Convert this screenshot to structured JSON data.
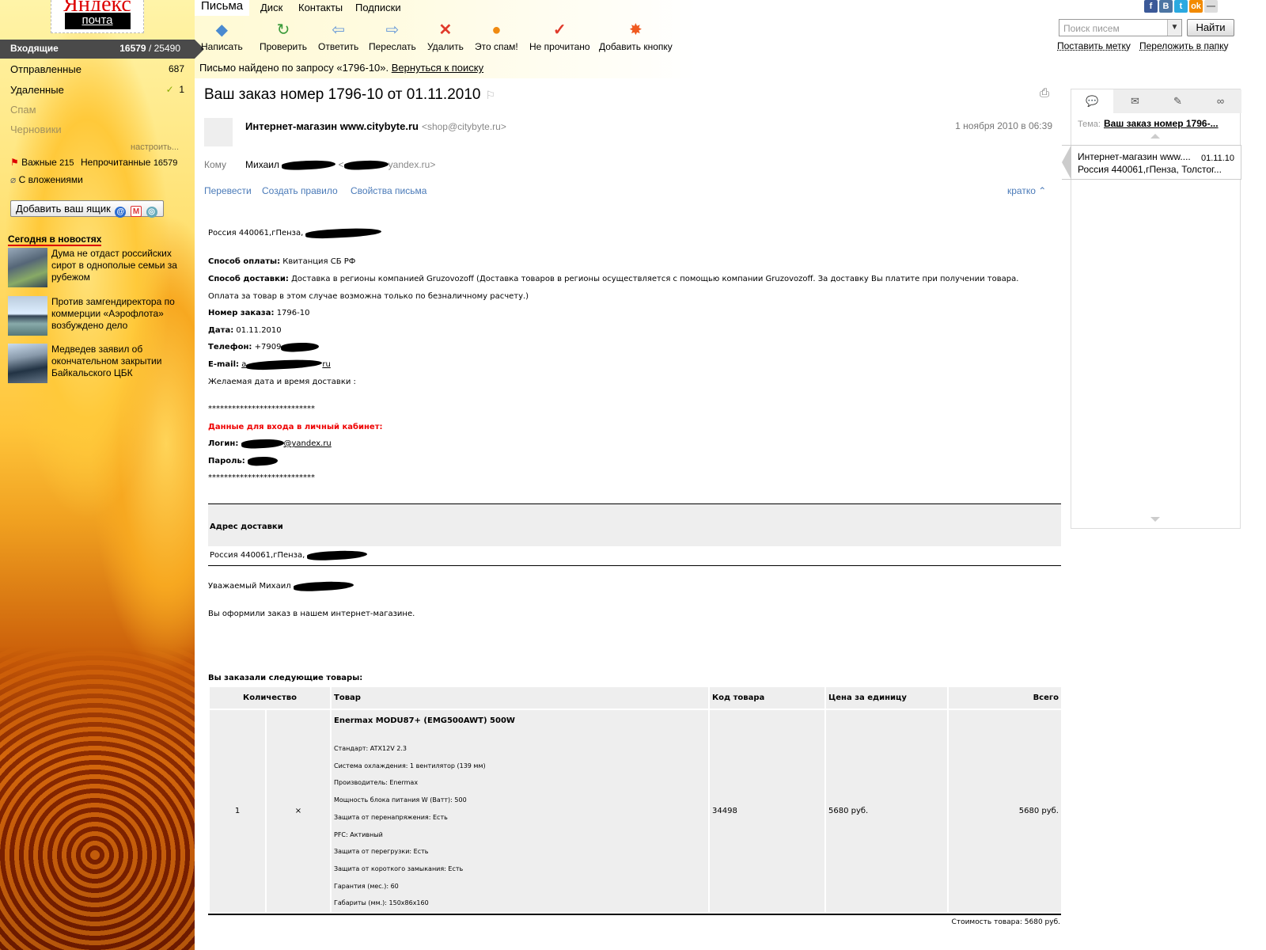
{
  "logo": {
    "brand": "Яндекс",
    "service": "почта"
  },
  "tabs": [
    {
      "label": "Письма",
      "active": true
    },
    {
      "label": "Диск"
    },
    {
      "label": "Контакты"
    },
    {
      "label": "Подписки"
    }
  ],
  "social": [
    "f",
    "B",
    "t",
    "ok",
    "—"
  ],
  "toolbar": [
    {
      "label": "Написать",
      "icon": "compose-icon"
    },
    {
      "label": "Проверить",
      "icon": "refresh-icon"
    },
    {
      "label": "Ответить",
      "icon": "reply-icon"
    },
    {
      "label": "Переслать",
      "icon": "forward-icon"
    },
    {
      "label": "Удалить",
      "icon": "delete-icon"
    },
    {
      "label": "Это спам!",
      "icon": "spam-icon"
    },
    {
      "label": "Не прочитано",
      "icon": "unread-icon"
    },
    {
      "label": "Добавить кнопку",
      "icon": "add-button-icon"
    }
  ],
  "search": {
    "placeholder": "Поиск писем",
    "button": "Найти",
    "put_label": "Поставить метку",
    "move": "Переложить в папку"
  },
  "found": {
    "text": "Письмо найдено по запросу «1796-10».",
    "back": "Вернуться к поиску"
  },
  "folders": {
    "inbox": {
      "label": "Входящие",
      "unread": "16579",
      "sep": " / ",
      "total": "25490"
    },
    "items": [
      {
        "label": "Отправленные",
        "count": "687"
      },
      {
        "label": "Удаленные",
        "count": "1"
      },
      {
        "label": "Спам",
        "count": ""
      },
      {
        "label": "Черновики",
        "count": ""
      }
    ],
    "tune": "настроить..."
  },
  "labels": {
    "important": "Важные",
    "important_count": "215",
    "unread": "Непрочитанные",
    "unread_count": "16579",
    "attach": "С вложениями"
  },
  "add_box": "Добавить ваш ящик",
  "news": {
    "title": "Сегодня в новостях",
    "items": [
      "Дума не отдаст российских сирот в однополые семьи за рубежом",
      "Против замгендиректора по коммерции «Аэрофлота» возбуждено дело",
      "Медведев заявил об окончательном закрытии Байкальского ЦБК"
    ]
  },
  "message": {
    "subject": "Ваш заказ номер 1796-10 от 01.11.2010",
    "sender_name": "Интернет-магазин www.citybyte.ru",
    "sender_addr": "<shop@citybyte.ru>",
    "date": "1 ноября 2010 в 06:39",
    "to_label": "Кому",
    "to_name": "Михаил",
    "to_addr_open": "<",
    "to_addr": "yandex.ru>",
    "actions": [
      "Перевести",
      "Создать правило",
      "Свойства письма"
    ],
    "brief": "кратко"
  },
  "body": {
    "addr1": "Россия 440061,гПенза,",
    "pay_label": "Способ оплаты:",
    "pay": "Квитанция СБ РФ",
    "ship_label": "Способ доставки:",
    "ship": "Доставка в регионы компанией Gruzovozoff (Доставка товаров в регионы осуществляется с помощью компании Gruzovozoff. За доставку Вы платите при получении товара.",
    "ship2": "Оплата за товар в этом случае возможна только по безналичному расчету.)",
    "order_label": "Номер заказа:",
    "order": "1796-10",
    "date_label": "Дата:",
    "date": "01.11.2010",
    "phone_label": "Телефон:",
    "phone": "+7909",
    "email_label": "E-mail:",
    "email_start": "a",
    "email_end": "ru",
    "wish": "Желаемая дата и время доставки :",
    "stars": "***************************",
    "cabinet": "Данные для входа в личный кабинет:",
    "login_label": "Логин:",
    "login_tail": "@yandex.ru",
    "pass_label": "Пароль:",
    "addr_head": "Адрес доставки",
    "addr2": "Россия 440061,гПенза,",
    "dear": "Уважаемый Михаил",
    "placed": "Вы оформили заказ в нашем интернет-магазине.",
    "ordered": "Вы заказали следующие товары:"
  },
  "goods": {
    "headers": [
      "Количество",
      "Товар",
      "Код товара",
      "Цена за единицу",
      "Всего"
    ],
    "qty": "1",
    "x": "×",
    "name": "Enermax MODU87+ (EMG500AWT) 500W",
    "specs": [
      "Стандарт: ATX12V 2.3",
      "Система охлаждения: 1 вентилятор (139 мм)",
      "Производитель: Enermax",
      "Мощность блока питания W (Ватт): 500",
      "Защита от перенапряжения: Есть",
      "PFC: Активный",
      "Защита от перегрузки: Есть",
      "Защита от короткого замыкания: Есть",
      "Гарантия (мес.): 60",
      "Габариты (мм.): 150x86x160"
    ],
    "code": "34498",
    "price": "5680 руб.",
    "total": "5680 руб.",
    "sum": "Стоимость товара: 5680 руб."
  },
  "right": {
    "theme_label": "Тема:",
    "theme": "Ваш заказ номер 1796-...",
    "thread_from": "Интернет-магазин www....",
    "thread_date": "01.11.10",
    "thread_text": "Россия 440061,гПенза, Толстог..."
  },
  "colors": {
    "accent": "#cc0000",
    "link": "#4a7ab8",
    "inbox_bg": "#4a4a4a"
  }
}
